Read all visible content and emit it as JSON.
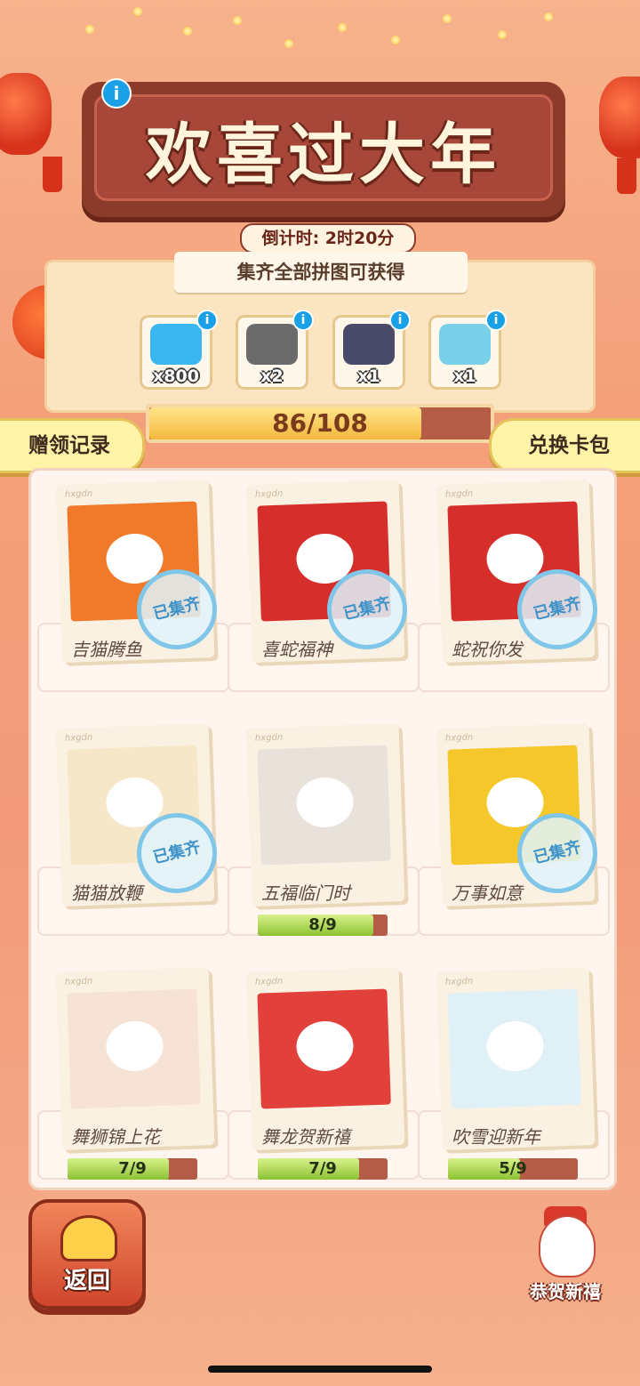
{
  "header": {
    "title": "欢喜过大年",
    "countdown": "倒计时: 2时20分"
  },
  "rewards_panel": {
    "banner": "集齐全部拼图可获得",
    "items": [
      {
        "name": "diamond",
        "qty": "x800",
        "color": "#3ab6f0"
      },
      {
        "name": "raccoon-fortune-cat",
        "qty": "x2",
        "color": "#6b6b6b"
      },
      {
        "name": "star-card",
        "qty": "x1",
        "color": "#4a4a6a"
      },
      {
        "name": "mahjong-tile",
        "qty": "x1",
        "color": "#7ad0e8"
      }
    ]
  },
  "progress": {
    "label": "86/108",
    "value": 86,
    "max": 108
  },
  "side_buttons": {
    "left": "赠领记录",
    "right": "兑换卡包"
  },
  "album": {
    "brand": "hxgdn",
    "stamp_text": "已集齐",
    "cards": [
      {
        "name": "吉猫腾鱼",
        "collected": true,
        "art_color": "#f07a2a"
      },
      {
        "name": "喜蛇福神",
        "collected": true,
        "art_color": "#d62e2a"
      },
      {
        "name": "蛇祝你发",
        "collected": true,
        "art_color": "#d62e2a"
      },
      {
        "name": "猫猫放鞭",
        "collected": true,
        "art_color": "#f6e7c8"
      },
      {
        "name": "五福临门时",
        "collected": false,
        "progress": "8/9",
        "value": 8,
        "max": 9,
        "art_color": "#e9e2da"
      },
      {
        "name": "万事如意",
        "collected": true,
        "art_color": "#f5c72a"
      },
      {
        "name": "舞狮锦上花",
        "collected": false,
        "progress": "7/9",
        "value": 7,
        "max": 9,
        "art_color": "#f6e3d6"
      },
      {
        "name": "舞龙贺新禧",
        "collected": false,
        "progress": "7/9",
        "value": 7,
        "max": 9,
        "art_color": "#e2403a"
      },
      {
        "name": "吹雪迎新年",
        "collected": false,
        "progress": "5/9",
        "value": 5,
        "max": 9,
        "art_color": "#dff0f6"
      }
    ]
  },
  "bottom": {
    "back_label": "返回",
    "greeting_label": "恭贺新禧"
  }
}
